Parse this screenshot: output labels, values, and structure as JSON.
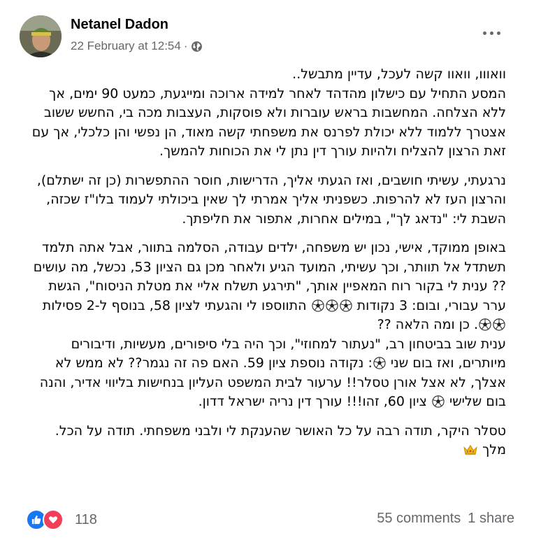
{
  "post": {
    "author": "Netanel Dadon",
    "timestamp": "22 February at 12:54",
    "separator": "·",
    "privacy_icon": "globe-icon",
    "more_icon": "more-horizontal-icon",
    "avatar_icon": "profile-photo"
  },
  "body": {
    "p1": [
      {
        "t": "וואווו, וואוו קשה לעכל, עדיין מתבשל..",
        "br": true
      },
      {
        "t": "המסע התחיל עם כישלון מהדהד לאחר למידה ארוכה ומייגעת, כמעט 90 ימים, אך ללא הצלחה. המחשבות בראש עוברות ולא פוסקות, העצבות מכה בי, החשש ששוב אצטרך ללמוד ללא יכולת לפרנס את משפחתי קשה מאוד, הן נפשי והן כלכלי, אך עם זאת הרצון להצליח ולהיות עורך דין נתן לי את הכוחות להמשך."
      }
    ],
    "p2": [
      {
        "t": "נרגעתי, עשיתי חושבים, ואז הגעתי אליך, הדרישות, חוסר ההתפשרות (כן זה ישתלם), והרצון העז לא להרפות. כשפניתי אליך אמרתי לך שאין ביכולתי לעמוד בלו\"ז שכזה, השבת לי: \"נדאג לך\", במילים אחרות, אתפור את חליפתך."
      }
    ],
    "p3": [
      {
        "t": "באופן ממוקד, אישי, נכון יש משפחה, ילדים עבודה, הסלמה בתוור, אבל אתה תלמד תשתדל אל תוותר, וכך עשיתי, המועד הגיע ולאחר מכן גם הציון 53, נכשל, מה עושים ?? ענית לי בקור רוח המאפיין אותך, \"תירגע תשלח אליי את מטלת הניסוח\", הגשת ערר עבורי, ובום: 3 נקודות "
      },
      {
        "balls": 3
      },
      {
        "t": " התווספו לי והגעתי לציון 58, בנוסף ל-2 פסילות "
      },
      {
        "balls": 2
      },
      {
        "t": ". כן ומה הלאה ??",
        "br": true
      },
      {
        "t": "ענית שוב בביטחון רב, \"נעתור למחוזי\", וכך היה בלי סיפורים, מעשיות, ודיבורים מיותרים, ואז בום שני "
      },
      {
        "balls": 1
      },
      {
        "t": ": נקודה נוספת ציון 59. האם פה זה נגמר?? לא ממש לא אצלך, לא אצל אורן טסלר!! ערעור לבית המשפט העליון בנחישות בליווי אדיר, והנה בום שלישי "
      },
      {
        "balls": 1
      },
      {
        "t": " ציון 60, זהו!!! עורך דין נריה ישראל דדון."
      }
    ],
    "p4": [
      {
        "t": "טסלר היקר, תודה רבה על כל האושר שהענקת לי ולבני משפחתי. תודה על הכל.",
        "br": true
      },
      {
        "t": "מלך "
      },
      {
        "crown": true
      }
    ],
    "emoji_icons": {
      "ball": "soccer-ball-icon",
      "crown": "crown-icon"
    }
  },
  "footer": {
    "reactions_count": "118",
    "comments": "55 comments",
    "shares": "1 share",
    "like_icon": "like-reaction-icon",
    "love_icon": "love-reaction-icon",
    "colors": {
      "like": "#1877f2",
      "love": "#f33e58",
      "muted": "#65676b"
    }
  }
}
